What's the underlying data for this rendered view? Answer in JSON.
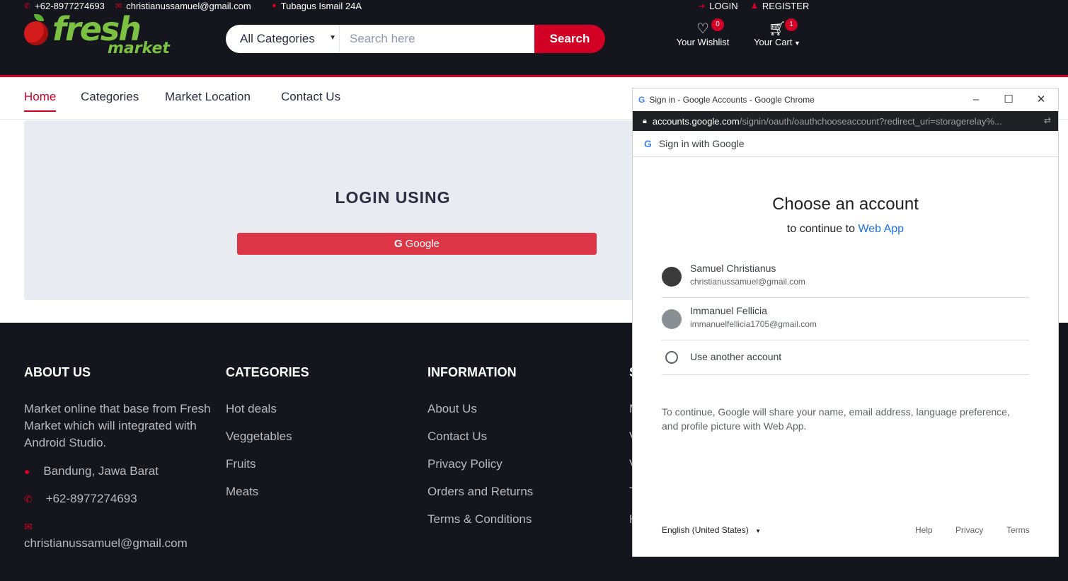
{
  "topbar": {
    "phone": "+62-8977274693",
    "email": "christianussamuel@gmail.com",
    "address": "Tubagus Ismail 24A",
    "login": "LOGIN",
    "register": "REGISTER"
  },
  "logo": {
    "word1": "fresh",
    "word2": "market"
  },
  "search": {
    "category": "All Categories",
    "placeholder": "Search here",
    "button": "Search"
  },
  "wishlist": {
    "label": "Your Wishlist",
    "count": "0"
  },
  "cart": {
    "label": "Your Cart",
    "count": "1"
  },
  "nav": [
    "Home",
    "Categories",
    "Market Location",
    "Contact Us"
  ],
  "login": {
    "title": "LOGIN USING",
    "google_button": "Google"
  },
  "footer": {
    "about": {
      "title": "ABOUT US",
      "text": "Market online that base from Fresh Market which will integrated with Android Studio.",
      "location": "Bandung, Jawa Barat",
      "phone": "+62-8977274693",
      "email": "christianussamuel@gmail.com"
    },
    "categories": {
      "title": "CATEGORIES",
      "items": [
        "Hot deals",
        "Veggetables",
        "Fruits",
        "Meats"
      ]
    },
    "information": {
      "title": "INFORMATION",
      "items": [
        "About Us",
        "Contact Us",
        "Privacy Policy",
        "Orders and Returns",
        "Terms & Conditions"
      ]
    },
    "service": {
      "title_initial": "S",
      "items_initials": [
        "M",
        "V",
        "V",
        "T",
        "H"
      ]
    }
  },
  "popup": {
    "window_title": "Sign in - Google Accounts - Google Chrome",
    "url_domain": "accounts.google.com",
    "url_path": "/signin/oauth/oauthchooseaccount?redirect_uri=storagerelay%...",
    "sub_header": "Sign in with Google",
    "heading": "Choose an account",
    "continue_prefix": "to continue to",
    "app_name": "Web App",
    "accounts": [
      {
        "name": "Samuel Christianus",
        "email": "christianussamuel@gmail.com"
      },
      {
        "name": "Immanuel Fellicia",
        "email": "immanuelfellicia1705@gmail.com"
      }
    ],
    "use_another": "Use another account",
    "note": "To continue, Google will share your name, email address, language preference, and profile picture with Web App.",
    "language": "English (United States)",
    "help": "Help",
    "privacy": "Privacy",
    "terms": "Terms"
  }
}
